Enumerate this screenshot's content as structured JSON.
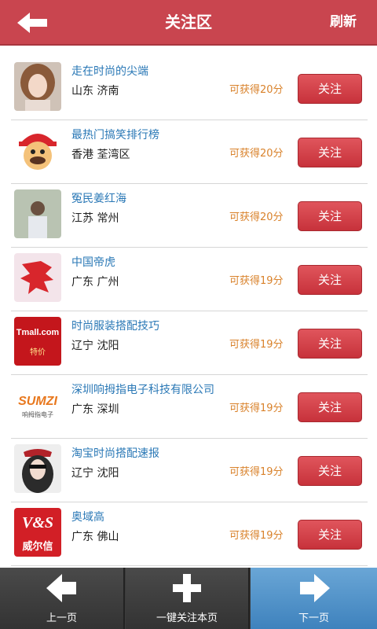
{
  "header": {
    "title": "关注区",
    "refresh_label": "刷新"
  },
  "items": [
    {
      "name": "走在时尚的尖端",
      "location": "山东 济南",
      "points": "可获得20分",
      "button": "关注",
      "avatar": "photo-woman-avatar"
    },
    {
      "name": "最热门搞笑排行榜",
      "location": "香港 荃湾区",
      "points": "可获得20分",
      "button": "关注",
      "avatar": "mario-cartoon-avatar"
    },
    {
      "name": "冤民姜红海",
      "location": "江苏 常州",
      "points": "可获得20分",
      "button": "关注",
      "avatar": "photo-man-avatar"
    },
    {
      "name": "中国帝虎",
      "location": "广东 广州",
      "points": "可获得19分",
      "button": "关注",
      "avatar": "tiger-logo-avatar"
    },
    {
      "name": "时尚服装搭配技巧",
      "location": "辽宁 沈阳",
      "points": "可获得19分",
      "button": "关注",
      "avatar": "tmall-logo-avatar",
      "avatar_text": "Tmall.com",
      "avatar_sub": "特价"
    },
    {
      "name": "深圳响拇指电子科技有限公司",
      "location": "广东 深圳",
      "points": "可获得19分",
      "button": "关注",
      "avatar": "sumzi-logo-avatar",
      "avatar_text": "SUMZI",
      "avatar_sub": "响拇指电子"
    },
    {
      "name": "淘宝时尚搭配速报",
      "location": "辽宁 沈阳",
      "points": "可获得19分",
      "button": "关注",
      "avatar": "fashion-woman-avatar"
    },
    {
      "name": "奥域高",
      "location": "广东 佛山",
      "points": "可获得19分",
      "button": "关注",
      "avatar": "vs-logo-avatar",
      "avatar_text": "V&S",
      "avatar_sub": "威尔信"
    }
  ],
  "footer": {
    "prev_label": "上一页",
    "follow_all_label": "一键关注本页",
    "next_label": "下一页"
  },
  "colors": {
    "accent": "#c9454f",
    "link": "#2a78b6",
    "points": "#d9822b",
    "next_active": "#4a8fc8"
  }
}
